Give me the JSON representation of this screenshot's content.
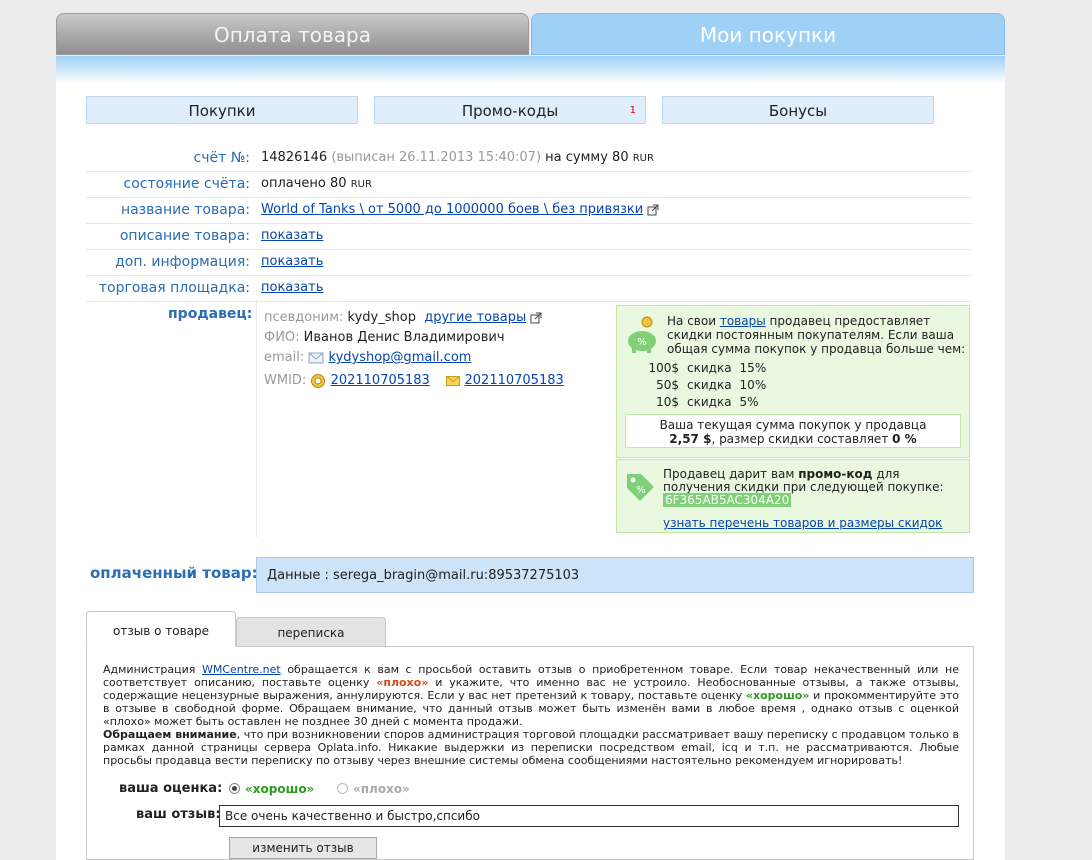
{
  "top_tabs": {
    "payment": "Оплата товара",
    "my_purchases": "Мои покупки"
  },
  "sub_tabs": {
    "purchases": "Покупки",
    "promo_codes": "Промо-коды",
    "promo_badge": "1",
    "bonuses": "Бонусы"
  },
  "invoice": {
    "label": "счёт №:",
    "number": "14826146",
    "issued": "(выписан 26.11.2013 15:40:07)",
    "sum_prefix": "на сумму 80",
    "currency": "RUR"
  },
  "status": {
    "label": "состояние счёта:",
    "value": "оплачено 80",
    "currency": "RUR"
  },
  "product_name": {
    "label": "название товара:",
    "value": "World of Tanks \\ от 5000 до 1000000 боев \\ без привязки"
  },
  "product_desc": {
    "label": "описание товара:",
    "link": "показать"
  },
  "extra_info": {
    "label": "доп. информация:",
    "link": "показать"
  },
  "marketplace": {
    "label": "торговая площадка:",
    "link": "показать"
  },
  "seller": {
    "label": "продавец:",
    "nick_key": "псевдоним:",
    "nick": "kydy_shop",
    "other_goods": "другие товары",
    "fio_key": "ФИО:",
    "fio": "Иванов Денис Владимирович",
    "email_key": "email:",
    "email": "kydyshop@gmail.com",
    "wmid_key": "WMID:",
    "wmid1": "202110705183",
    "wmid2": "202110705183"
  },
  "discount": {
    "text_a": "На свои",
    "text_link": "товары",
    "text_b": "продавец предоставляет скидки постоянным покупателям. Если ваша общая сумма покупок у продавца больше чем:",
    "rows": [
      {
        "amount": "100$",
        "word": "скидка",
        "pct": "15%"
      },
      {
        "amount": "50$",
        "word": "скидка",
        "pct": "10%"
      },
      {
        "amount": "10$",
        "word": "скидка",
        "pct": "5%"
      }
    ],
    "current_line": "Ваша текущая сумма покупок у продавца",
    "current_sum": "2,57 $",
    "current_mid": ", размер скидки составляет",
    "current_pct": "0 %"
  },
  "promo": {
    "text_a": "Продавец дарит вам",
    "text_bold": "промо-код",
    "text_b": "для получения скидки при следующей покупке:",
    "code": "6F365AB5AC304A20",
    "link": "узнать перечень товаров и размеры скидок"
  },
  "paid_goods": {
    "label": "оплаченный товар:",
    "value": "Данные : serega_bragin@mail.ru:89537275103"
  },
  "review_tabs": {
    "review": "отзыв о товаре",
    "chat": "переписка"
  },
  "review": {
    "p1_a": "Администрация",
    "p1_link": "WMCentre.net",
    "p1_b": "обращается к вам с просьбой оставить отзыв о приобретенном товаре. Если товар некачественный или не соответствует описанию, поставьте оценку",
    "p1_bad": "«плохо»",
    "p1_c": "и укажите, что именно вас не устроило. Необоснованные отзывы, а также отзывы, содержащие нецензурные выражения, аннулируются. Если у вас нет претензий к товару, поставьте оценку",
    "p1_good": "«хорошо»",
    "p1_d": "и прокомментируйте это в отзыве в свободной форме. Обращаем внимание, что данный отзыв может быть изменён вами в любое время , однако отзыв с оценкой «плохо» может быть оставлен не позднее 30 дней с момента продажи.",
    "p2_bold": "Обращаем внимание",
    "p2_text": ", что при возникновении споров администрация торговой площадки рассматривает вашу переписку с продавцом только в рамках данной страницы сервера Oplata.info. Никакие выдержки из переписки посредством email, icq и т.п. не рассматриваются. Любые просьбы продавца вести переписку по отзыву через внешние системы обмена сообщениями настоятельно рекомендуем игнорировать!",
    "rating_label": "ваша оценка:",
    "good": "«хорошо»",
    "bad": "«плохо»",
    "review_label": "ваш отзыв:",
    "review_text": "Все очень качественно и быстро,спсибо",
    "submit": "изменить отзыв"
  },
  "colors": {
    "accent_blue": "#9fd0f6",
    "label_blue": "#2a6db5",
    "good_green": "#2f9a20",
    "bad_red": "#d24d1c"
  }
}
